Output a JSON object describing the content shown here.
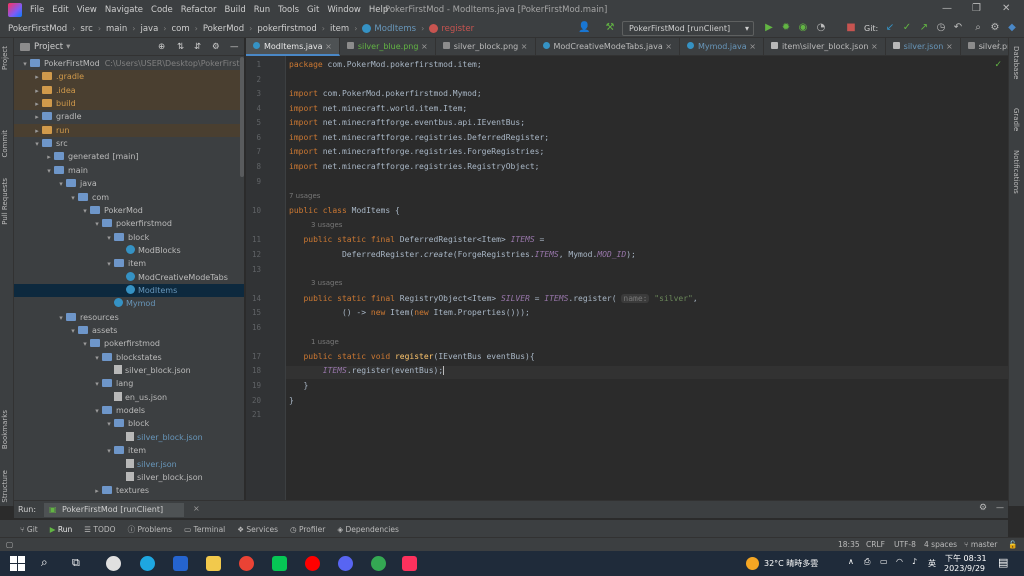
{
  "menu": [
    "File",
    "Edit",
    "View",
    "Navigate",
    "Code",
    "Refactor",
    "Build",
    "Run",
    "Tools",
    "Git",
    "Window",
    "Help"
  ],
  "window_title": "PokerFirstMod - ModItems.java [PokerFirstMod.main]",
  "breadcrumbs": [
    "PokerFirstMod",
    "src",
    "main",
    "java",
    "com",
    "PokerMod",
    "pokerfirstmod",
    "item",
    "ModItems",
    "register"
  ],
  "run_config": "PokerFirstMod [runClient]",
  "git_label": "Git:",
  "project_panel": {
    "title": "Project",
    "root_path": "C:\\Users\\USER\\Desktop\\PokerFirstMo",
    "tree": [
      {
        "label": "PokerFirstMod",
        "style": "root"
      },
      {
        "label": ".gradle",
        "style": "excluded"
      },
      {
        "label": ".idea",
        "style": "excluded"
      },
      {
        "label": "build",
        "style": "excluded"
      },
      {
        "label": "gradle",
        "style": "folder"
      },
      {
        "label": "run",
        "style": "excluded"
      },
      {
        "label": "src",
        "style": "folder"
      },
      {
        "label": "generated",
        "suffix": "[main]",
        "style": "folder"
      },
      {
        "label": "main",
        "style": "folder"
      },
      {
        "label": "java",
        "style": "folder"
      },
      {
        "label": "com",
        "style": "folder"
      },
      {
        "label": "PokerMod",
        "style": "folder"
      },
      {
        "label": "pokerfirstmod",
        "style": "folder"
      },
      {
        "label": "block",
        "style": "folder"
      },
      {
        "label": "ModBlocks",
        "style": "class"
      },
      {
        "label": "item",
        "style": "folder"
      },
      {
        "label": "ModCreativeModeTabs",
        "style": "class"
      },
      {
        "label": "ModItems",
        "style": "class-selected"
      },
      {
        "label": "Mymod",
        "style": "class-blue"
      },
      {
        "label": "resources",
        "style": "folder"
      },
      {
        "label": "assets",
        "style": "folder"
      },
      {
        "label": "pokerfirstmod",
        "style": "folder"
      },
      {
        "label": "blockstates",
        "style": "folder"
      },
      {
        "label": "silver_block.json",
        "style": "json"
      },
      {
        "label": "lang",
        "style": "folder"
      },
      {
        "label": "en_us.json",
        "style": "json"
      },
      {
        "label": "models",
        "style": "folder"
      },
      {
        "label": "block",
        "style": "folder"
      },
      {
        "label": "silver_block.json",
        "style": "json-blue"
      },
      {
        "label": "item",
        "style": "folder"
      },
      {
        "label": "silver.json",
        "style": "json-blue"
      },
      {
        "label": "silver_block.json",
        "style": "json"
      },
      {
        "label": "textures",
        "style": "folder"
      }
    ]
  },
  "editor_tabs": [
    {
      "label": "ModItems.java",
      "active": true
    },
    {
      "label": "silver_blue.png"
    },
    {
      "label": "silver_block.png"
    },
    {
      "label": "ModCreativeModeTabs.java"
    },
    {
      "label": "Mymod.java"
    },
    {
      "label": "item\\silver_block.json"
    },
    {
      "label": "silver.json"
    },
    {
      "label": "silver.png"
    }
  ],
  "code": {
    "line_numbers": [
      "1",
      "2",
      "3",
      "4",
      "5",
      "6",
      "7",
      "8",
      "9",
      "10",
      "11",
      "12",
      "13",
      "14",
      "15",
      "16",
      "17",
      "18",
      "19",
      "20",
      "21"
    ],
    "package": "com.PokerMod.pokerfirstmod.item;",
    "imports": [
      "com.PokerMod.pokerfirstmod.Mymod;",
      "net.minecraft.world.item.Item;",
      "net.minecraftforge.eventbus.api.IEventBus;",
      "net.minecraftforge.registries.DeferredRegister;",
      "net.minecraftforge.registries.ForgeRegistries;",
      "net.minecraftforge.registries.RegistryObject;"
    ],
    "usages_class": "7 usages",
    "class_name": "ModItems",
    "usages_items": "3 usages",
    "usages_silver": "3 usages",
    "usages_register": "1 usage",
    "param_hint": "name:",
    "silver_string": "\"silver\""
  },
  "run_panel": {
    "label": "Run:",
    "tab": "PokerFirstMod [runClient]"
  },
  "bottom_tabs": [
    "Git",
    "Run",
    "TODO",
    "Problems",
    "Terminal",
    "Services",
    "Profiler",
    "Dependencies"
  ],
  "status": {
    "position": "18:35",
    "line_sep": "CRLF",
    "encoding": "UTF-8",
    "indent": "4 spaces",
    "branch": "master"
  },
  "right_stripe": [
    "Database",
    "Gradle",
    "Notifications"
  ],
  "left_stripe": [
    "Project",
    "Commit",
    "Pull Requests",
    "Bookmarks",
    "Structure"
  ],
  "taskbar": {
    "weather": "32°C 晴時多雲",
    "ime": "英",
    "time": "下午 08:31",
    "date": "2023/9/29"
  }
}
